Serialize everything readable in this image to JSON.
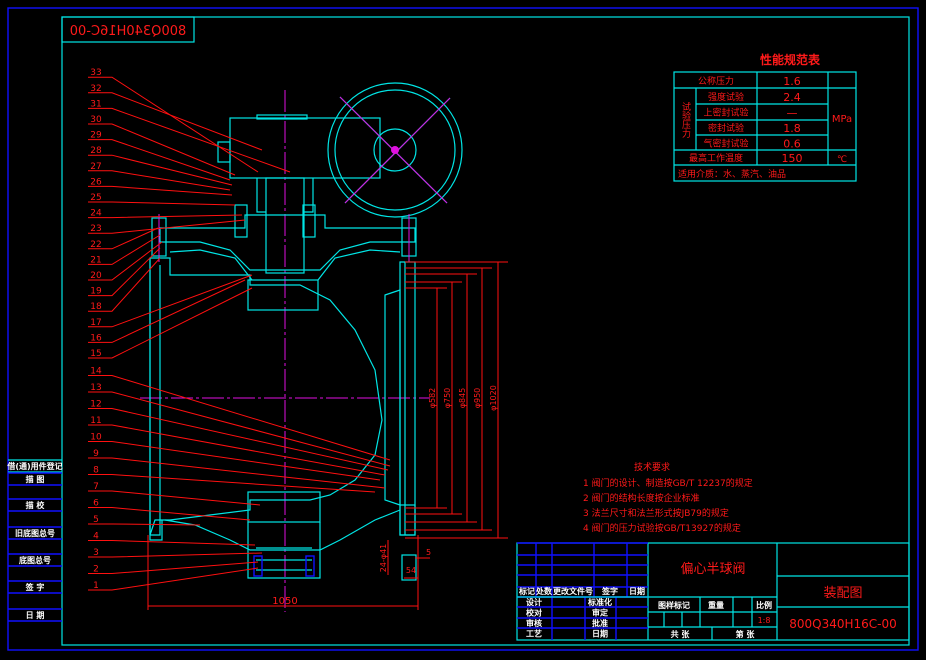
{
  "drawing": {
    "mirrored_code": "800Q340H16C-00",
    "callout_numbers": [
      "1",
      "2",
      "3",
      "4",
      "5",
      "6",
      "7",
      "8",
      "9",
      "10",
      "11",
      "12",
      "13",
      "14",
      "15",
      "16",
      "17",
      "18",
      "19",
      "20",
      "21",
      "22",
      "23",
      "24",
      "25",
      "26",
      "27",
      "28",
      "29",
      "30",
      "31",
      "32",
      "33"
    ],
    "dimensions": {
      "d1": "φ582",
      "d2": "φ750",
      "d3": "φ845",
      "d4": "φ950",
      "d5": "φ1020",
      "length": "1050",
      "bolt_holes": "24-φ41",
      "flange_thk": "54",
      "raised_face": "5"
    }
  },
  "performance_table": {
    "title": "性能规范表",
    "nominal_pressure_label": "公称压力",
    "nominal_pressure": "1.6",
    "test_pressure_label": "试验压力",
    "rows": [
      {
        "label": "强度试验",
        "value": "2.4"
      },
      {
        "label": "上密封试验",
        "value": "—"
      },
      {
        "label": "密封试验",
        "value": "1.8"
      },
      {
        "label": "气密封试验",
        "value": "0.6"
      }
    ],
    "pressure_unit": "MPa",
    "max_temp_label": "最高工作温度",
    "max_temp": "150",
    "temp_unit": "℃",
    "medium": "适用介质：水、蒸汽、油品"
  },
  "tech_requirements": {
    "heading": "技术要求",
    "items": [
      "1  阀门的设计、制造按GB/T 12237的规定",
      "2  阀门的结构长度按企业标准",
      "3  法兰尺寸和法兰形式按JB79的规定",
      "4  阀门的压力试验按GB/T13927的规定"
    ]
  },
  "title_block": {
    "product_name": "偏心半球阀",
    "drawing_type": "装配图",
    "drawing_code": "800Q340H16C-00",
    "revision_header": [
      "标记",
      "处数",
      "更改文件号",
      "签字",
      "日期"
    ],
    "sign_rows": [
      [
        "设计",
        "标准化"
      ],
      [
        "校对",
        "审定"
      ],
      [
        "审核",
        "批准"
      ],
      [
        "工艺",
        "日期"
      ]
    ],
    "attr_header": [
      "图样标记",
      "重量",
      "比例"
    ],
    "scale": "1:8",
    "sheet_total": "共  张",
    "sheet_no": "第  张"
  },
  "left_strip": [
    "借(通)用件登记",
    "描 图",
    "描 校",
    "旧底图总号",
    "底图总号",
    "签 字",
    "日 期"
  ],
  "colors": {
    "outline": "#00e5e5",
    "text": "#ff1a1a",
    "grid": "#1010ff",
    "centerline": "#e010e0",
    "background": "#000000"
  }
}
